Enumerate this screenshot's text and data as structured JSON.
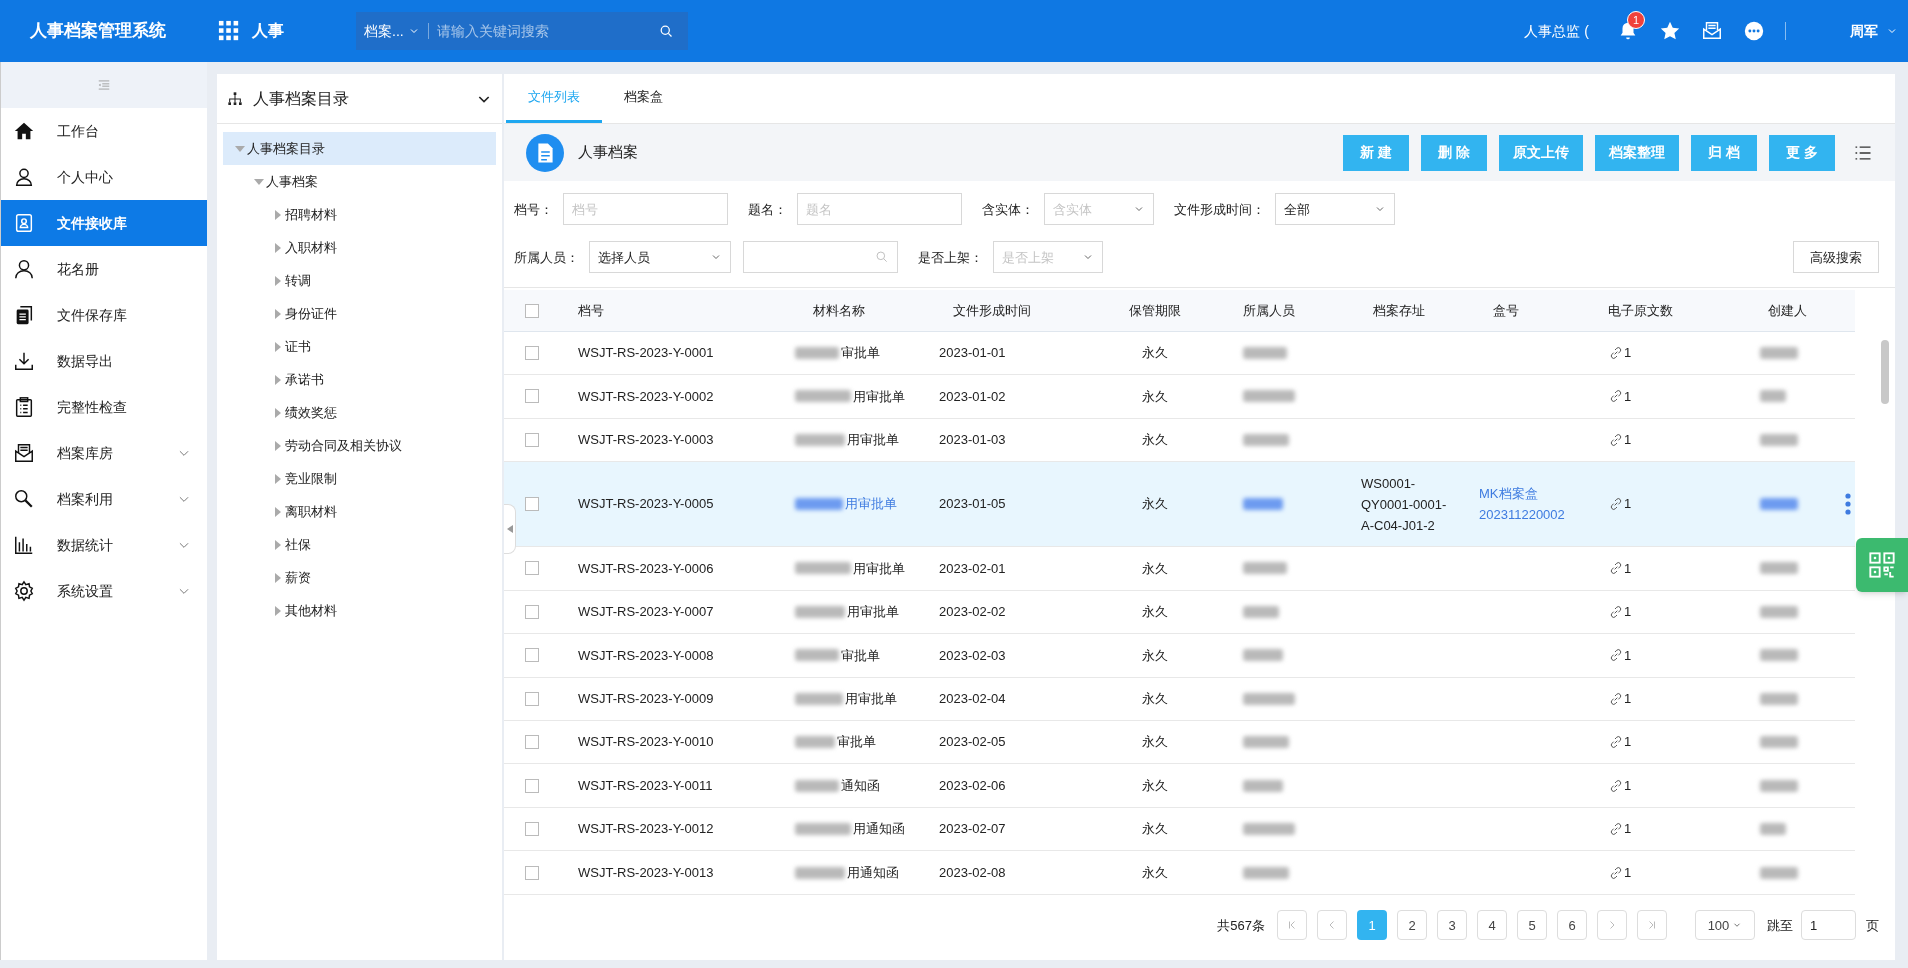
{
  "header": {
    "app_title": "人事档案管理系统",
    "module": "人事",
    "search": {
      "scope": "档案...",
      "placeholder": "请输入关键词搜索"
    },
    "role": "人事总监 (",
    "notification_count": "1",
    "user": "周军"
  },
  "sidebar": {
    "items": [
      {
        "label": "工作台",
        "selected": false,
        "expandable": false
      },
      {
        "label": "个人中心",
        "selected": false,
        "expandable": false
      },
      {
        "label": "文件接收库",
        "selected": true,
        "expandable": false
      },
      {
        "label": "花名册",
        "selected": false,
        "expandable": false
      },
      {
        "label": "文件保存库",
        "selected": false,
        "expandable": false
      },
      {
        "label": "数据导出",
        "selected": false,
        "expandable": false
      },
      {
        "label": "完整性检查",
        "selected": false,
        "expandable": false
      },
      {
        "label": "档案库房",
        "selected": false,
        "expandable": true
      },
      {
        "label": "档案利用",
        "selected": false,
        "expandable": true
      },
      {
        "label": "数据统计",
        "selected": false,
        "expandable": true
      },
      {
        "label": "系统设置",
        "selected": false,
        "expandable": true
      }
    ]
  },
  "tree": {
    "title": "人事档案目录",
    "nodes": [
      {
        "label": "人事档案目录",
        "selected": true,
        "expanded": true,
        "children": [
          {
            "label": "人事档案",
            "selected": false,
            "expanded": true,
            "children": [
              {
                "label": "招聘材料",
                "selected": false,
                "expanded": false
              },
              {
                "label": "入职材料",
                "selected": false,
                "expanded": false
              },
              {
                "label": "转调",
                "selected": false,
                "expanded": false
              },
              {
                "label": "身份证件",
                "selected": false,
                "expanded": false
              },
              {
                "label": "证书",
                "selected": false,
                "expanded": false
              },
              {
                "label": "承诺书",
                "selected": false,
                "expanded": false
              },
              {
                "label": "绩效奖惩",
                "selected": false,
                "expanded": false
              },
              {
                "label": "劳动合同及相关协议",
                "selected": false,
                "expanded": false
              },
              {
                "label": "竞业限制",
                "selected": false,
                "expanded": false
              },
              {
                "label": "离职材料",
                "selected": false,
                "expanded": false
              },
              {
                "label": "社保",
                "selected": false,
                "expanded": false
              },
              {
                "label": "薪资",
                "selected": false,
                "expanded": false
              },
              {
                "label": "其他材料",
                "selected": false,
                "expanded": false
              }
            ]
          }
        ]
      }
    ]
  },
  "tabs": [
    {
      "label": "文件列表",
      "selected": true
    },
    {
      "label": "档案盒",
      "selected": false
    }
  ],
  "panel": {
    "title": "人事档案",
    "buttons": [
      "新 建",
      "删 除",
      "原文上传",
      "档案整理",
      "归 档",
      "更 多"
    ]
  },
  "filters": [
    [
      {
        "label": "档号：",
        "kind": "input",
        "placeholder": "档号"
      },
      {
        "label": "题名：",
        "kind": "input",
        "placeholder": "题名"
      },
      {
        "label": "含实体：",
        "kind": "select",
        "placeholder": "含实体"
      },
      {
        "label": "文件形成时间：",
        "kind": "select",
        "value": "全部"
      }
    ],
    [
      {
        "label": "所属人员：",
        "kind": "select",
        "value": "选择人员"
      },
      {
        "kind": "search"
      },
      {
        "label": "是否上架：",
        "kind": "select",
        "placeholder": "是否上架"
      }
    ]
  ],
  "advanced_search": "高级搜索",
  "table": {
    "header_checked": false,
    "columns": [
      "档号",
      "材料名称",
      "文件形成时间",
      "保管期限",
      "所属人员",
      "档案存址",
      "盒号",
      "电子原文数",
      "创建人"
    ],
    "rows": [
      {
        "checked": false,
        "selected": false,
        "doc_no": "WSJT-RS-2023-Y-0001",
        "material": "审批单",
        "date": "2023-01-01",
        "retention": "永久",
        "file_count": "1"
      },
      {
        "checked": false,
        "selected": false,
        "doc_no": "WSJT-RS-2023-Y-0002",
        "material": "用审批单",
        "date": "2023-01-02",
        "retention": "永久",
        "file_count": "1"
      },
      {
        "checked": false,
        "selected": false,
        "doc_no": "WSJT-RS-2023-Y-0003",
        "material": "用审批单",
        "date": "2023-01-03",
        "retention": "永久",
        "file_count": "1"
      },
      {
        "checked": false,
        "selected": true,
        "doc_no": "WSJT-RS-2023-Y-0005",
        "material": "用审批单",
        "date": "2023-01-05",
        "retention": "永久",
        "location": "WS0001-QY0001-0001-A-C04-J01-2",
        "box_no": "MK档案盒202311220002",
        "file_count": "1",
        "has_menu": true
      },
      {
        "checked": false,
        "selected": false,
        "doc_no": "WSJT-RS-2023-Y-0006",
        "material": "用审批单",
        "date": "2023-02-01",
        "retention": "永久",
        "file_count": "1"
      },
      {
        "checked": false,
        "selected": false,
        "doc_no": "WSJT-RS-2023-Y-0007",
        "material": "用审批单",
        "date": "2023-02-02",
        "retention": "永久",
        "file_count": "1"
      },
      {
        "checked": false,
        "selected": false,
        "doc_no": "WSJT-RS-2023-Y-0008",
        "material": "审批单",
        "date": "2023-02-03",
        "retention": "永久",
        "file_count": "1"
      },
      {
        "checked": false,
        "selected": false,
        "doc_no": "WSJT-RS-2023-Y-0009",
        "material": "用审批单",
        "date": "2023-02-04",
        "retention": "永久",
        "file_count": "1"
      },
      {
        "checked": false,
        "selected": false,
        "doc_no": "WSJT-RS-2023-Y-0010",
        "material": "审批单",
        "date": "2023-02-05",
        "retention": "永久",
        "file_count": "1"
      },
      {
        "checked": false,
        "selected": false,
        "doc_no": "WSJT-RS-2023-Y-0011",
        "material": "通知函",
        "date": "2023-02-06",
        "retention": "永久",
        "file_count": "1"
      },
      {
        "checked": false,
        "selected": false,
        "doc_no": "WSJT-RS-2023-Y-0012",
        "material": "用通知函",
        "date": "2023-02-07",
        "retention": "永久",
        "file_count": "1"
      },
      {
        "checked": false,
        "selected": false,
        "doc_no": "WSJT-RS-2023-Y-0013",
        "material": "用通知函",
        "date": "2023-02-08",
        "retention": "永久",
        "file_count": "1"
      }
    ]
  },
  "pagination": {
    "total": "共567条",
    "pages": [
      {
        "label": "1",
        "selected": true
      },
      {
        "label": "2",
        "selected": false
      },
      {
        "label": "3",
        "selected": false
      },
      {
        "label": "4",
        "selected": false
      },
      {
        "label": "5",
        "selected": false
      },
      {
        "label": "6",
        "selected": false
      }
    ],
    "page_size": "100",
    "jump_label": "跳至",
    "jump_value": "1",
    "page_unit": "页"
  }
}
